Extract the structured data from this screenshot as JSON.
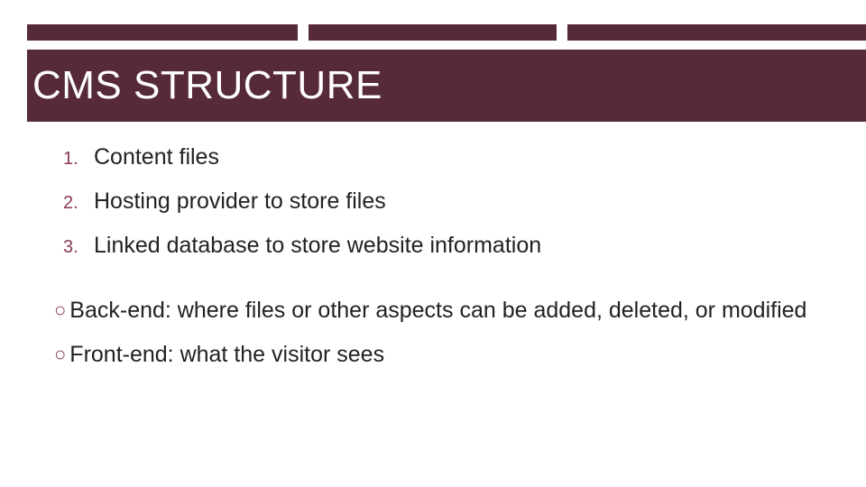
{
  "title": "CMS STRUCTURE",
  "numbered": [
    {
      "n": "1.",
      "text": "Content files"
    },
    {
      "n": "2.",
      "text": "Hosting provider to store files"
    },
    {
      "n": "3.",
      "text": "Linked database to store website information"
    }
  ],
  "bullets": [
    {
      "text": "Back-end: where files or other aspects can be added, deleted, or modified"
    },
    {
      "text": "Front-end: what the visitor sees"
    }
  ],
  "bullet_glyph": "○",
  "colors": {
    "accent": "#572a3a",
    "accent_light": "#8a3b54"
  }
}
